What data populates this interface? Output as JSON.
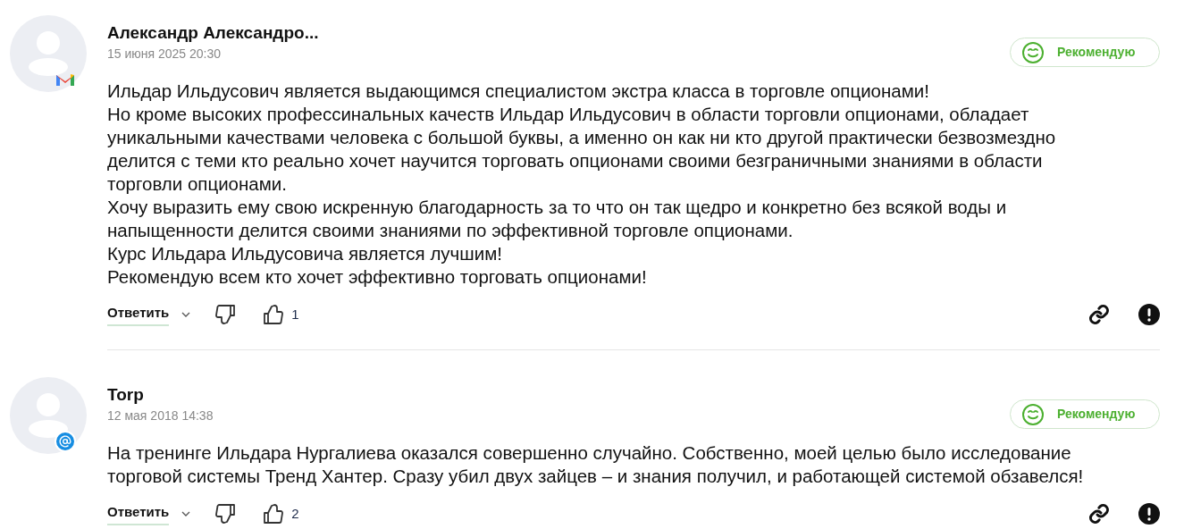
{
  "reviews": [
    {
      "author": "Александр Александро...",
      "date": "15 июня 2025 20:30",
      "kind": "gmail",
      "recommend": "Рекомендую",
      "paragraphs": [
        "Ильдар Ильдусович является выдающимся специалистом экстра класса в торговле опционами!",
        "Но кроме высоких профессинальных качеств Ильдар Ильдусович в области торговли опционами, обладает уникальными качествами человека с большой буквы, а именно он как ни кто другой практически безвозмездно делится с теми кто реально хочет научится торговать опционами своими безграничными знаниями в области торговли опционами.",
        "Хочу выразить ему свою искренную благодарность за то что он так щедро и конкретно без всякой воды и напыщенности делится своими знаниями по эффективной торговле опционами.",
        "Курс Ильдара Ильдусовича является лучшим!",
        "Рекомендую всем кто хочет эффективно торговать опционами!"
      ],
      "reply": "Ответить",
      "likes": "1"
    },
    {
      "author": "Torp",
      "date": "12 мая 2018 14:38",
      "kind": "mail",
      "recommend": "Рекомендую",
      "paragraphs": [
        "На тренинге Ильдара Нургалиева оказался совершенно случайно. Собственно, моей целью было исследование торговой системы Тренд Хантер. Сразу убил двух зайцев – и знания получил, и работающей системой обзавелся!"
      ],
      "reply": "Ответить",
      "likes": "2"
    }
  ]
}
